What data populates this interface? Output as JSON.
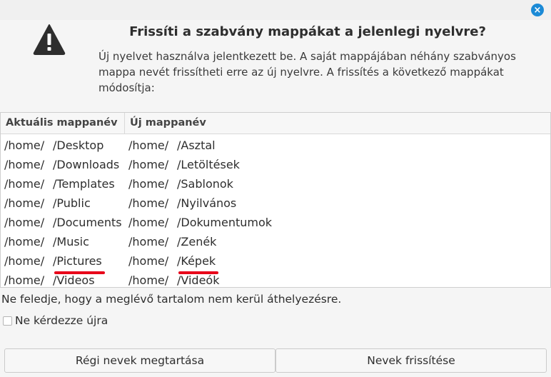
{
  "window": {
    "close_glyph": "×"
  },
  "dialog": {
    "icon": "warning-icon",
    "title": "Frissíti a szabvány mappákat a jelenlegi nyelvre?",
    "description": "Új nyelvet használva jelentkezett be. A saját mappájában néhány szabványos mappa nevét frissítheti erre az új nyelvre. A frissítés a következő mappákat módosítja:"
  },
  "table": {
    "headers": [
      "Aktuális mappanév",
      "Új mappanév"
    ],
    "rows": [
      {
        "old_home": "/home/",
        "old": "/Desktop",
        "new_home": "/home/",
        "new": "/Asztal"
      },
      {
        "old_home": "/home/",
        "old": "/Downloads",
        "new_home": "/home/",
        "new": "/Letöltések"
      },
      {
        "old_home": "/home/",
        "old": "/Templates",
        "new_home": "/home/",
        "new": "/Sablonok"
      },
      {
        "old_home": "/home/",
        "old": "/Public",
        "new_home": "/home/",
        "new": "/Nyilvános"
      },
      {
        "old_home": "/home/",
        "old": "/Documents",
        "new_home": "/home/",
        "new": "/Dokumentumok"
      },
      {
        "old_home": "/home/",
        "old": "/Music",
        "new_home": "/home/",
        "new": "/Zenék"
      },
      {
        "old_home": "/home/",
        "old": "/Pictures",
        "new_home": "/home/",
        "new": "/Képek"
      },
      {
        "old_home": "/home/",
        "old": "/Videos",
        "new_home": "/home/",
        "new": "/Videók"
      }
    ]
  },
  "note": "Ne feledje, hogy a meglévő tartalom nem kerül áthelyezésre.",
  "checkbox": {
    "label": "Ne kérdezze újra",
    "checked": false
  },
  "buttons": {
    "keep": "Régi nevek megtartása",
    "update": "Nevek frissítése"
  },
  "colors": {
    "accent": "#1b8ad6",
    "highlight_underline": "#e8001a"
  }
}
